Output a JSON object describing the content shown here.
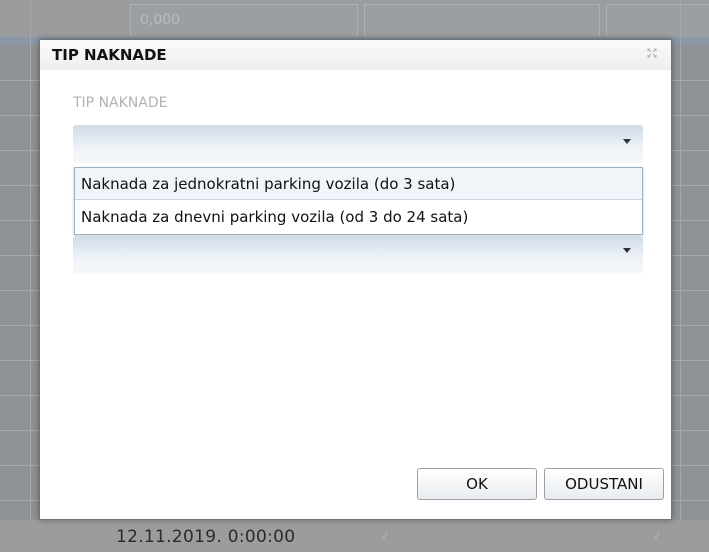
{
  "background": {
    "top_value": "0,000",
    "bottom_date": "12.11.2019. 0:00:00",
    "check_glyph": "✓"
  },
  "dialog": {
    "title": "TIP NAKNADE",
    "close_icon": "close-icon",
    "field_label": "TIP NAKNADE",
    "select_value": "",
    "options": [
      "Naknada za jednokratni parking vozila (do 3 sata)",
      "Naknada za dnevni parking vozila (od 3 do 24 sata)"
    ],
    "second_select_value": "",
    "ok_label": "OK",
    "cancel_label": "ODUSTANI"
  },
  "colors": {
    "overlay": "#8f9294",
    "select_gradient_top": "#cfdbe8"
  }
}
